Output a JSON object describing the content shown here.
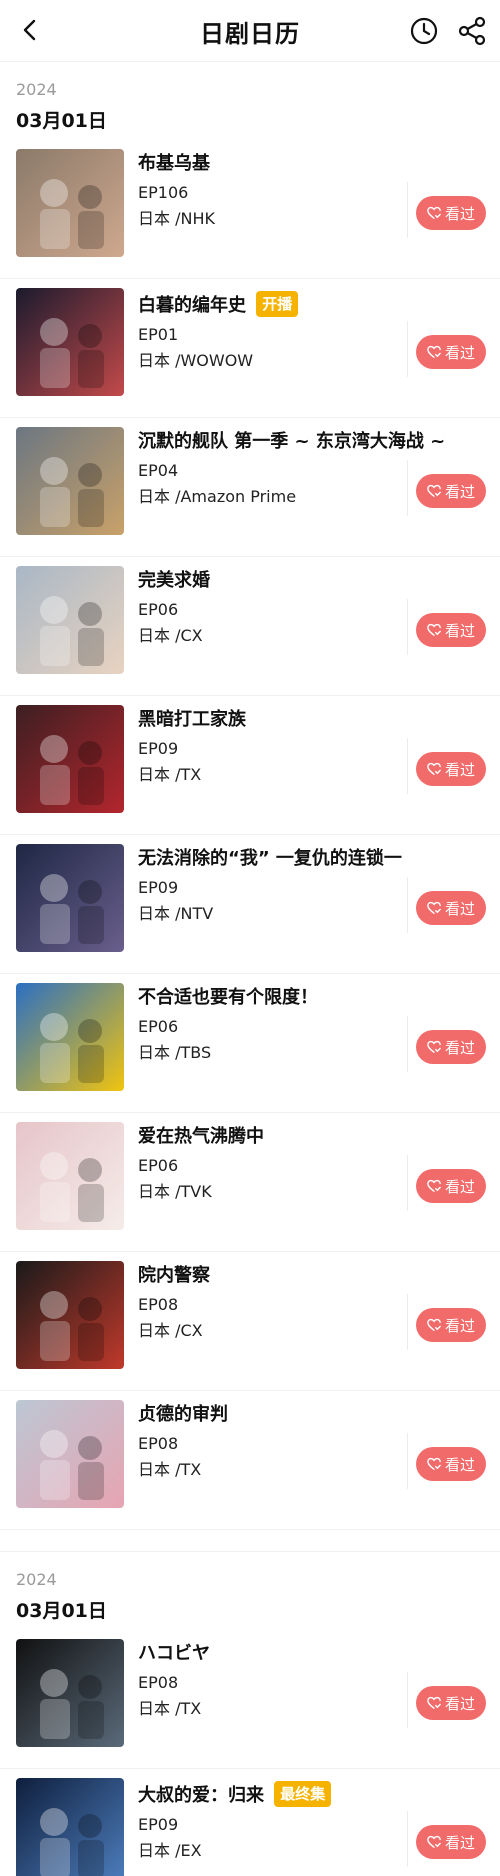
{
  "header": {
    "title": "日剧日历",
    "icons": [
      "chevron-left-icon",
      "clock-icon",
      "share-icon"
    ]
  },
  "accent": "#f26b6b",
  "badge_color": "#f5b300",
  "sections": [
    {
      "year": "2024",
      "date": "03月01日",
      "items": [
        {
          "title": "布基乌基",
          "badge": "",
          "episode": "EP106",
          "meta": "日本 /NHK",
          "action": "看过",
          "poster_colors": [
            "#8b7a6a",
            "#cfa88e"
          ]
        },
        {
          "title": "白暮的编年史",
          "badge": "开播",
          "episode": "EP01",
          "meta": "日本 /WOWOW",
          "action": "看过",
          "poster_colors": [
            "#1b1b2e",
            "#c34a4a"
          ]
        },
        {
          "title": "沉默的舰队 第一季 ~ 东京湾大海战 ~",
          "badge": "",
          "episode": "EP04",
          "meta": "日本 /Amazon Prime",
          "action": "看过",
          "poster_colors": [
            "#6c7782",
            "#c9a169"
          ]
        },
        {
          "title": "完美求婚",
          "badge": "",
          "episode": "EP06",
          "meta": "日本 /CX",
          "action": "看过",
          "poster_colors": [
            "#a9b7c6",
            "#e8d3c0"
          ]
        },
        {
          "title": "黑暗打工家族",
          "badge": "",
          "episode": "EP09",
          "meta": "日本 /TX",
          "action": "看过",
          "poster_colors": [
            "#3c1f22",
            "#b3262d"
          ]
        },
        {
          "title": "无法消除的“我” 一复仇的连锁一",
          "badge": "",
          "episode": "EP09",
          "meta": "日本 /NTV",
          "action": "看过",
          "poster_colors": [
            "#1e2744",
            "#6a5f8d"
          ]
        },
        {
          "title": "不合适也要有个限度！",
          "badge": "",
          "episode": "EP06",
          "meta": "日本 /TBS",
          "action": "看过",
          "poster_colors": [
            "#2b6fc2",
            "#f1c40f"
          ]
        },
        {
          "title": "爱在热气沸腾中",
          "badge": "",
          "episode": "EP06",
          "meta": "日本 /TVK",
          "action": "看过",
          "poster_colors": [
            "#e6c5c9",
            "#f5ece8"
          ]
        },
        {
          "title": "院内警察",
          "badge": "",
          "episode": "EP08",
          "meta": "日本 /CX",
          "action": "看过",
          "poster_colors": [
            "#1a1a1a",
            "#c0392b"
          ]
        },
        {
          "title": "贞德的审判",
          "badge": "",
          "episode": "EP08",
          "meta": "日本 /TX",
          "action": "看过",
          "poster_colors": [
            "#bcc7d4",
            "#e7a4b2"
          ]
        }
      ]
    },
    {
      "year": "2024",
      "date": "03月01日",
      "items": [
        {
          "title": "ハコビヤ",
          "badge": "",
          "episode": "EP08",
          "meta": "日本 /TX",
          "action": "看过",
          "poster_colors": [
            "#111111",
            "#5a6a7a"
          ]
        },
        {
          "title": "大叔的爱：归来",
          "badge": "最终集",
          "episode": "EP09",
          "meta": "日本 /EX",
          "action": "看过",
          "poster_colors": [
            "#0f1f3d",
            "#4e7fbf"
          ]
        }
      ]
    }
  ]
}
